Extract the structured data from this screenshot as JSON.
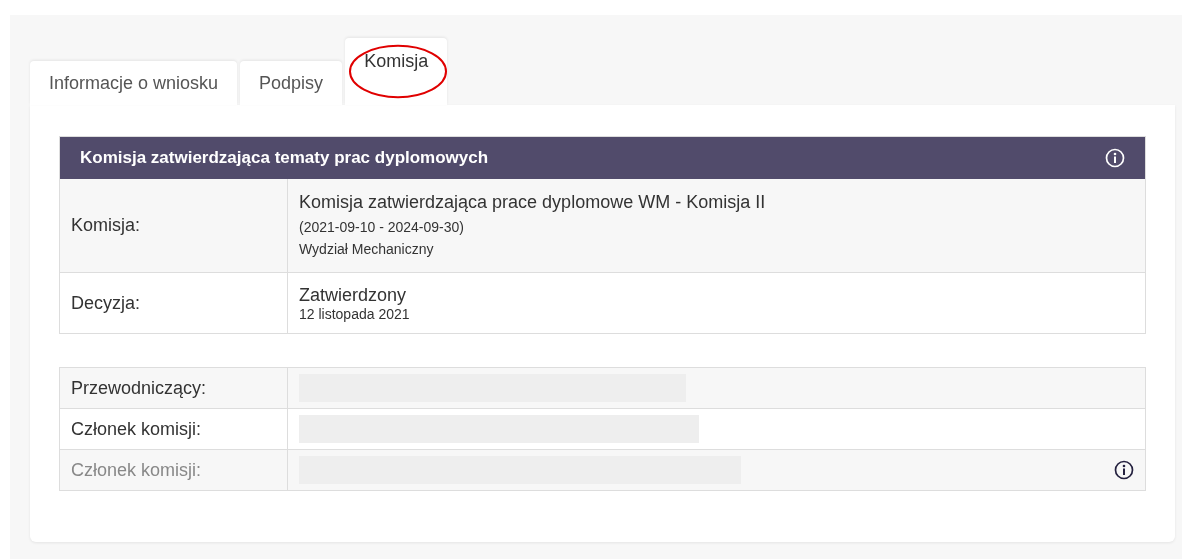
{
  "tabs": [
    {
      "label": "Informacje o wniosku",
      "selected": false,
      "highlighted": false
    },
    {
      "label": "Podpisy",
      "selected": false,
      "highlighted": false
    },
    {
      "label": "Komisja",
      "selected": true,
      "highlighted": true
    }
  ],
  "committee_table": {
    "title": "Komisja zatwierdzająca tematy prac dyplomowych",
    "rows": [
      {
        "label": "Komisja:",
        "lines": [
          "Komisja zatwierdzająca prace dyplomowe WM - Komisja II",
          "(2021-09-10 - 2024-09-30)",
          "Wydział Mechaniczny"
        ]
      },
      {
        "label": "Decyzja:",
        "lines": [
          "Zatwierdzony",
          "12 listopada 2021"
        ]
      }
    ]
  },
  "members": [
    {
      "label": "Przewodniczący:",
      "kind": "redacted",
      "inactive": false,
      "info": false
    },
    {
      "label": "Członek komisji:",
      "kind": "redacted",
      "inactive": false,
      "info": false
    },
    {
      "label": "Członek komisji:",
      "kind": "redacted",
      "inactive": true,
      "info": true
    }
  ]
}
